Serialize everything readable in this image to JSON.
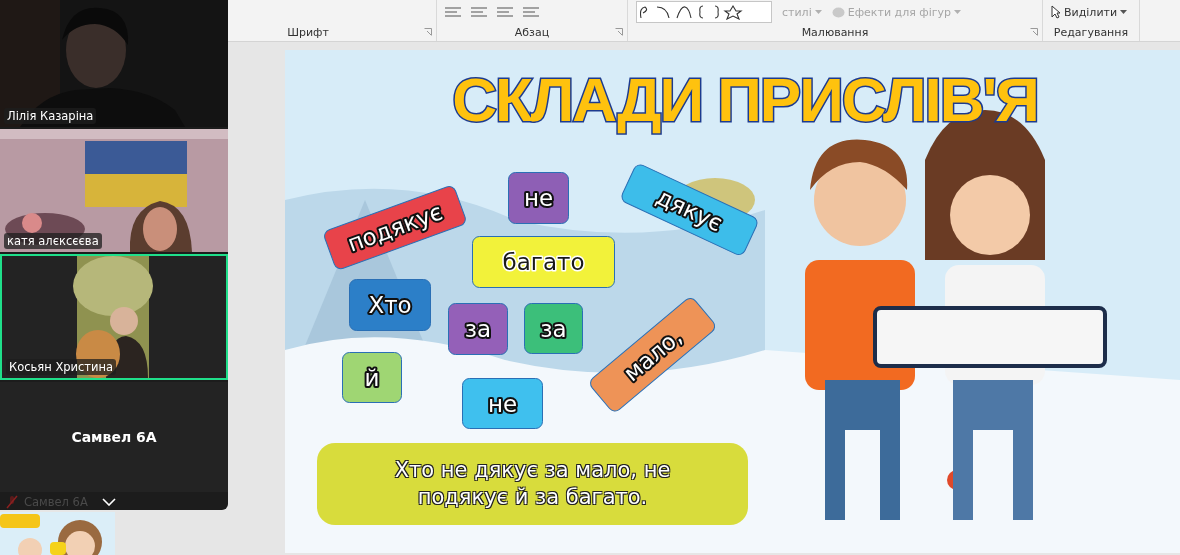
{
  "ribbon": {
    "groups": [
      {
        "label": "Шрифт",
        "launcher": true
      },
      {
        "label": "Абзац",
        "launcher": true
      },
      {
        "label": "Малювання",
        "launcher": true
      },
      {
        "label": "Редагування",
        "launcher": false
      }
    ],
    "items": [
      {
        "label": "стилі",
        "disabled": true
      },
      {
        "label": "Ефекти для фігур",
        "disabled": true
      },
      {
        "label": "Виділити",
        "disabled": false
      }
    ]
  },
  "meeting": {
    "participants": [
      {
        "name": "Лілія Казаріна",
        "kind": "video",
        "selected": false
      },
      {
        "name": "катя алєксєєва",
        "kind": "video",
        "selected": false
      },
      {
        "name": "Косьян Христина",
        "kind": "video",
        "selected": true
      },
      {
        "name": "Самвел 6А",
        "kind": "no-video",
        "selected": false
      }
    ],
    "footer": {
      "name": "Самвел 6А",
      "muted": true
    }
  },
  "slide": {
    "title": "СКЛАДИ ПРИСЛІВ'Я",
    "tiles": [
      {
        "text": "подякує",
        "color": "#e8434a"
      },
      {
        "text": "не",
        "color": "#8e5fb5"
      },
      {
        "text": "дякує",
        "color": "#3dbdea"
      },
      {
        "text": "багато",
        "color": "#f2f23a"
      },
      {
        "text": "Хто",
        "color": "#2c7fc8"
      },
      {
        "text": "за",
        "color": "#9460b8"
      },
      {
        "text": "за",
        "color": "#3cbf7a"
      },
      {
        "text": "мало,",
        "color": "#ee9357"
      },
      {
        "text": "й",
        "color": "#9fd673"
      },
      {
        "text": "не",
        "color": "#3fc0ee"
      }
    ],
    "answer": "Хто не дякує за мало, не подякує й за багато."
  }
}
